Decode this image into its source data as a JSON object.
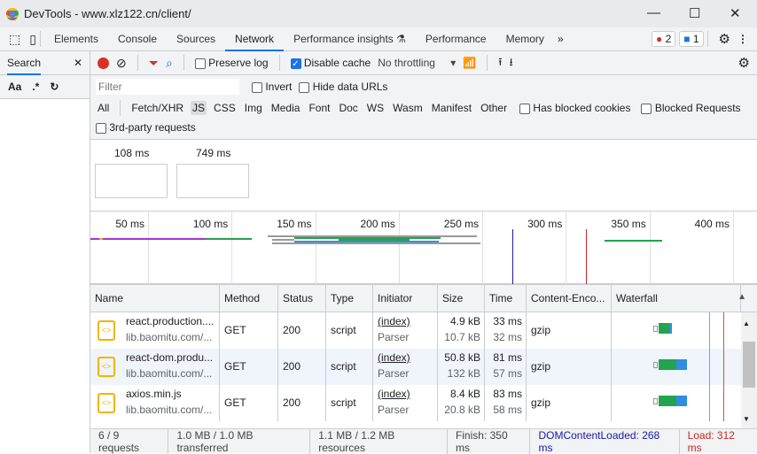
{
  "window": {
    "title": "DevTools - www.xlz122.cn/client/"
  },
  "tabs": [
    "Elements",
    "Console",
    "Sources",
    "Network",
    "Performance insights",
    "Performance",
    "Memory"
  ],
  "badges": {
    "errors": "2",
    "messages": "1"
  },
  "search_panel": {
    "tab": "Search",
    "case_label": "Aa",
    "regex_label": ".*"
  },
  "toolbar": {
    "preserve_log": "Preserve log",
    "preserve_log_checked": false,
    "disable_cache": "Disable cache",
    "disable_cache_checked": true,
    "throttling": "No throttling"
  },
  "filter": {
    "placeholder": "Filter",
    "invert": "Invert",
    "hide_data_urls": "Hide data URLs",
    "types": [
      "All",
      "Fetch/XHR",
      "JS",
      "CSS",
      "Img",
      "Media",
      "Font",
      "Doc",
      "WS",
      "Wasm",
      "Manifest",
      "Other"
    ],
    "active_type": "JS",
    "has_blocked_cookies": "Has blocked cookies",
    "blocked_requests": "Blocked Requests",
    "third_party": "3rd-party requests"
  },
  "screenshots": [
    "108 ms",
    "749 ms"
  ],
  "overview": {
    "ticks": [
      "50 ms",
      "100 ms",
      "150 ms",
      "200 ms",
      "250 ms",
      "300 ms",
      "350 ms",
      "400 ms"
    ],
    "colors": {
      "dom_content_loaded": "#1a1aa6",
      "load": "#c62828"
    }
  },
  "table": {
    "columns": [
      "Name",
      "Method",
      "Status",
      "Type",
      "Initiator",
      "Size",
      "Time",
      "Content-Enco...",
      "Waterfall"
    ],
    "rows": [
      {
        "name": "react.production....",
        "domain": "lib.baomitu.com/...",
        "method": "GET",
        "status": "200",
        "type": "script",
        "initiator": "(index)",
        "initiator_sub": "Parser",
        "size": "4.9 kB",
        "resource": "10.7 kB",
        "time": "33 ms",
        "latency": "32 ms",
        "encoding": "gzip"
      },
      {
        "name": "react-dom.produ...",
        "domain": "lib.baomitu.com/...",
        "method": "GET",
        "status": "200",
        "type": "script",
        "initiator": "(index)",
        "initiator_sub": "Parser",
        "size": "50.8 kB",
        "resource": "132 kB",
        "time": "81 ms",
        "latency": "57 ms",
        "encoding": "gzip"
      },
      {
        "name": "axios.min.js",
        "domain": "lib.baomitu.com/...",
        "method": "GET",
        "status": "200",
        "type": "script",
        "initiator": "(index)",
        "initiator_sub": "Parser",
        "size": "8.4 kB",
        "resource": "20.8 kB",
        "time": "83 ms",
        "latency": "58 ms",
        "encoding": "gzip"
      }
    ]
  },
  "status": {
    "requests": "6 / 9 requests",
    "transferred": "1.0 MB / 1.0 MB transferred",
    "resources": "1.1 MB / 1.2 MB resources",
    "finish": "Finish: 350 ms",
    "dom": "DOMContentLoaded: 268 ms",
    "load": "Load: 312 ms"
  }
}
